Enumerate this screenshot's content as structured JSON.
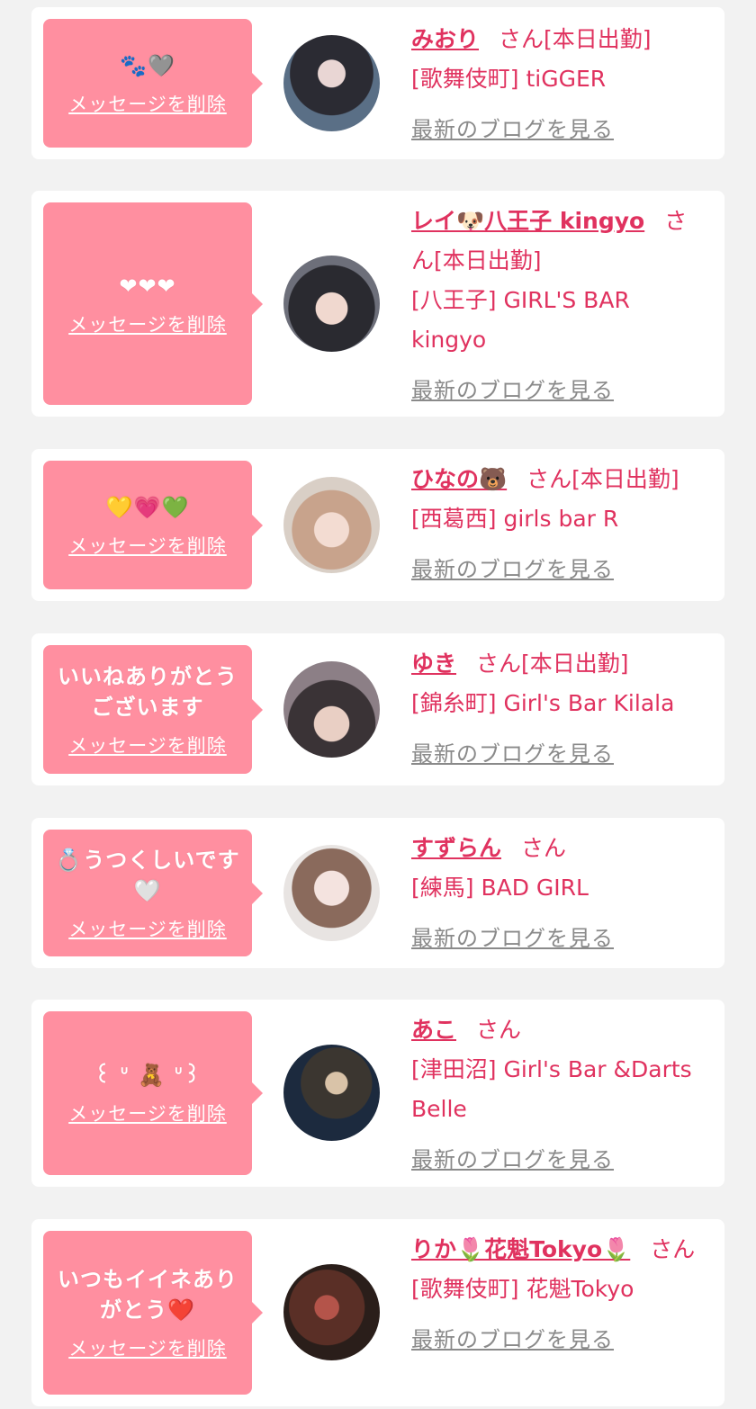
{
  "labels": {
    "delete": "メッセージを削除",
    "san": "さん",
    "blog": "最新のブログを見る"
  },
  "items": [
    {
      "message": "🐾🩶",
      "name": "みおり",
      "status": "[本日出勤]",
      "shop": "[歌舞伎町] tiGGER"
    },
    {
      "message": "❤❤❤",
      "name": "レイ🐶八王子 kingyo",
      "status": "[本日出勤]",
      "shop": "[八王子] GIRL'S BAR kingyo"
    },
    {
      "message": "💛💗💚",
      "name": "ひなの🐻",
      "status": "[本日出勤]",
      "shop": "[西葛西] girls bar R"
    },
    {
      "message": "いいねありがとうございます",
      "name": "ゆき",
      "status": "[本日出勤]",
      "shop": "[錦糸町] Girl's Bar Kilala"
    },
    {
      "message": "💍うつくしいです🤍",
      "name": "すずらん",
      "status": "",
      "shop": "[練馬] BAD GIRL"
    },
    {
      "message": "꒰ ᐡ 🧸 ᐡ꒱",
      "name": "あこ",
      "status": "",
      "shop": "[津田沼] Girl's Bar &Darts Belle"
    },
    {
      "message": "いつもイイネありがとう❤️",
      "name": "りか🌷花魁Tokyo🌷",
      "status": "",
      "shop": "[歌舞伎町] 花魁Tokyo"
    }
  ]
}
